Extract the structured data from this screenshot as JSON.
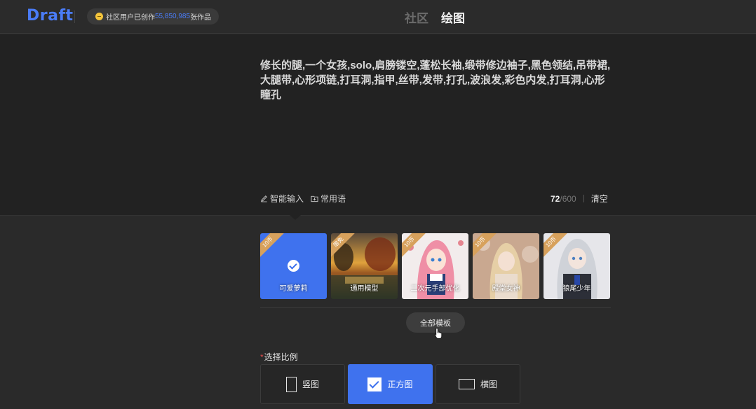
{
  "header": {
    "logo": "Draft",
    "stat_prefix": "社区用户已创作",
    "stat_count": "55,850,985",
    "stat_suffix": "张作品",
    "tabs": [
      {
        "label": "社区",
        "active": false
      },
      {
        "label": "绘图",
        "active": true
      }
    ]
  },
  "prompt": {
    "text": "修长的腿,一个女孩,solo,肩膀镂空,蓬松长袖,缎带修边袖子,黑色领结,吊带裙,大腿带,心形项链,打耳洞,指甲,丝带,发带,打孔,波浪发,彩色内发,打耳洞,心形瞳孔",
    "smart_input_label": "智能输入",
    "phrases_label": "常用语",
    "char_count": "72",
    "char_max": "/600",
    "clear_label": "清空"
  },
  "templates": [
    {
      "label": "可爱萝莉",
      "badge": "10币",
      "selected": true
    },
    {
      "label": "通用模型",
      "badge": "限免",
      "selected": false
    },
    {
      "label": "二次元手部优化",
      "badge": "10币",
      "selected": false
    },
    {
      "label": "殿堂女神",
      "badge": "10币",
      "selected": false
    },
    {
      "label": "狼尾少年",
      "badge": "10币",
      "selected": false
    }
  ],
  "all_templates_label": "全部模板",
  "ratio": {
    "required_mark": "*",
    "label": "选择比例",
    "options": [
      {
        "label": "竖图",
        "active": false
      },
      {
        "label": "正方图",
        "active": true
      },
      {
        "label": "横图",
        "active": false
      }
    ]
  },
  "colors": {
    "accent": "#3f72ee",
    "background": "#2a2a2a",
    "prompt_bg": "#222222",
    "badge": "#d7a15c"
  }
}
